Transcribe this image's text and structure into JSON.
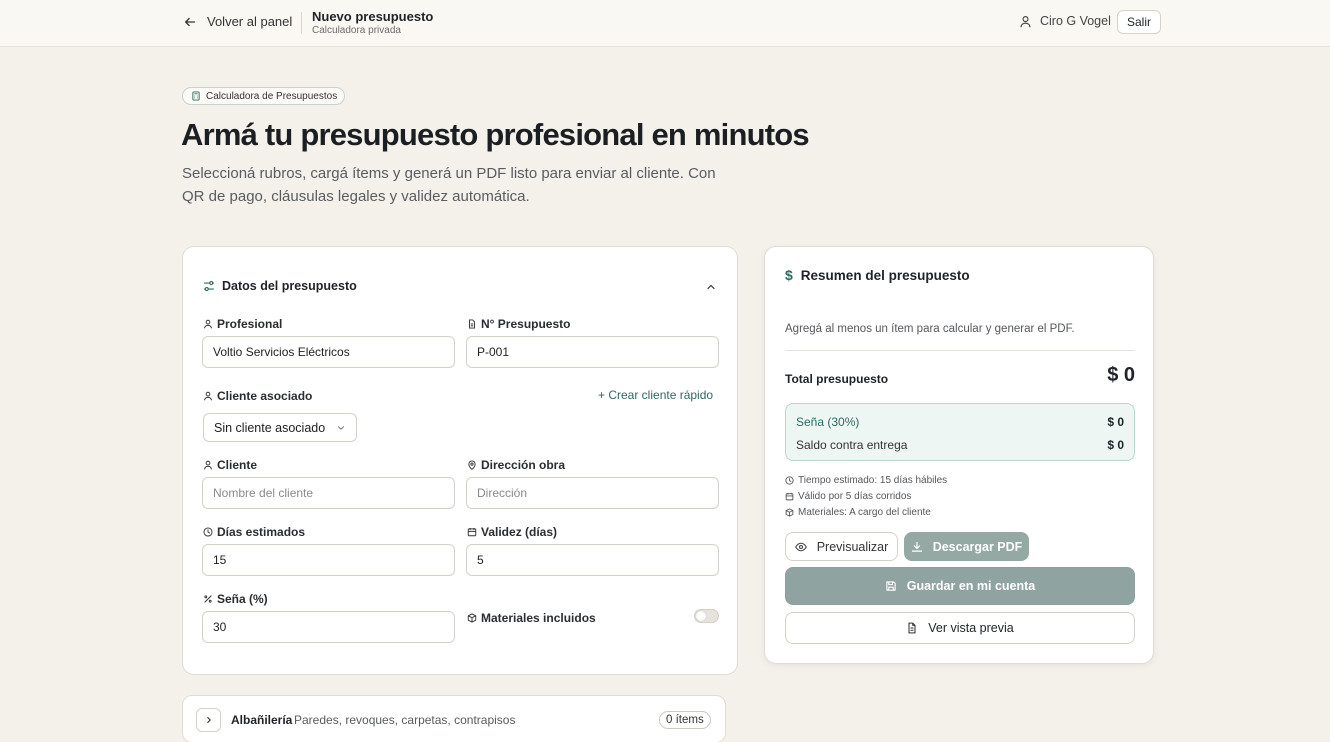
{
  "header": {
    "back_label": "Volver al panel",
    "title": "Nuevo presupuesto",
    "subtitle": "Calculadora privada",
    "user_name": "Ciro G Vogel",
    "logout_label": "Salir"
  },
  "hero": {
    "badge": "Calculadora de Presupuestos",
    "title": "Armá tu presupuesto profesional en minutos",
    "subtitle": "Seleccioná rubros, cargá ítems y generá un PDF listo para enviar al cliente. Con QR de pago, cláusulas legales y validez automática."
  },
  "form": {
    "section_title": "Datos del presupuesto",
    "profesional": {
      "label": "Profesional",
      "value": "Voltio Servicios Eléctricos"
    },
    "numero": {
      "label": "N° Presupuesto",
      "value": "P-001"
    },
    "cliente_asociado": {
      "label": "Cliente asociado",
      "quick_create": "+ Crear cliente rápido",
      "selected": "Sin cliente asociado"
    },
    "cliente": {
      "label": "Cliente",
      "placeholder": "Nombre del cliente"
    },
    "direccion": {
      "label": "Dirección obra",
      "placeholder": "Dirección"
    },
    "dias": {
      "label": "Días estimados",
      "value": "15"
    },
    "validez": {
      "label": "Validez (días)",
      "value": "5"
    },
    "sena": {
      "label": "Seña (%)",
      "value": "30"
    },
    "materiales": {
      "label": "Materiales incluidos",
      "enabled": false
    }
  },
  "summary": {
    "title": "Resumen del presupuesto",
    "hint": "Agregá al menos un ítem para calcular y generar el PDF.",
    "total_label": "Total presupuesto",
    "total_value": "$ 0",
    "sena_label": "Seña (30%)",
    "sena_value": "$ 0",
    "saldo_label": "Saldo contra entrega",
    "saldo_value": "$ 0",
    "meta": [
      "Tiempo estimado: 15 días hábiles",
      "Válido por 5 días corridos",
      "Materiales: A cargo del cliente"
    ],
    "preview_label": "Previsualizar",
    "pdf_label": "Descargar PDF",
    "save_label": "Guardar en mi cuenta",
    "view_label": "Ver vista previa"
  },
  "rubros": [
    {
      "name": "Albañilería",
      "description": "Paredes, revoques, carpetas, contrapisos",
      "count": "0 ítems"
    }
  ],
  "colors": {
    "accent": "#2e6a61",
    "background": "#f4f1ea",
    "disabled_button": "#8fa3a0"
  }
}
